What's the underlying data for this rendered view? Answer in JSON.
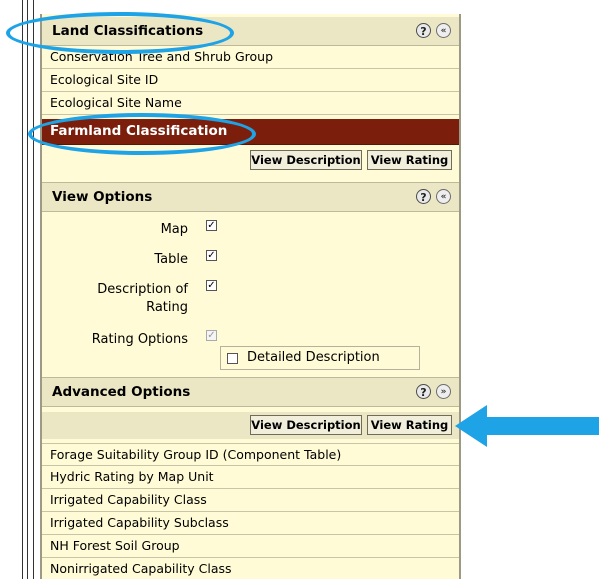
{
  "land_classifications": {
    "title": "Land Classifications",
    "items": [
      "Conservation Tree and Shrub Group",
      "Ecological Site ID",
      "Ecological Site Name",
      "Farmland Classification"
    ],
    "selected_index": 3,
    "view_description_label": "View Description",
    "view_rating_label": "View Rating"
  },
  "view_options": {
    "title": "View Options",
    "map_label": "Map",
    "table_label": "Table",
    "description_label_1": "Description of",
    "description_label_2": "Rating",
    "rating_options_label": "Rating Options",
    "detailed_description_label": "Detailed Description",
    "map_checked": true,
    "table_checked": true,
    "description_checked": true,
    "rating_options_checked": true,
    "detailed_description_checked": false
  },
  "advanced_options": {
    "title": "Advanced Options",
    "view_description_label": "View Description",
    "view_rating_label": "View Rating"
  },
  "lower_list": [
    "Forage Suitability Group ID (Component Table)",
    "Hydric Rating by Map Unit",
    "Irrigated Capability Class",
    "Irrigated Capability Subclass",
    "NH Forest Soil Group",
    "Nonirrigated Capability Class"
  ],
  "icons": {
    "help": "?",
    "collapse": "«",
    "expand": "»",
    "check": "✓"
  },
  "colors": {
    "panel_bg": "#fffbd6",
    "header_bg": "#ebe7c4",
    "selected_bg": "#7b1e0b",
    "annotation": "#1ea3e6"
  }
}
